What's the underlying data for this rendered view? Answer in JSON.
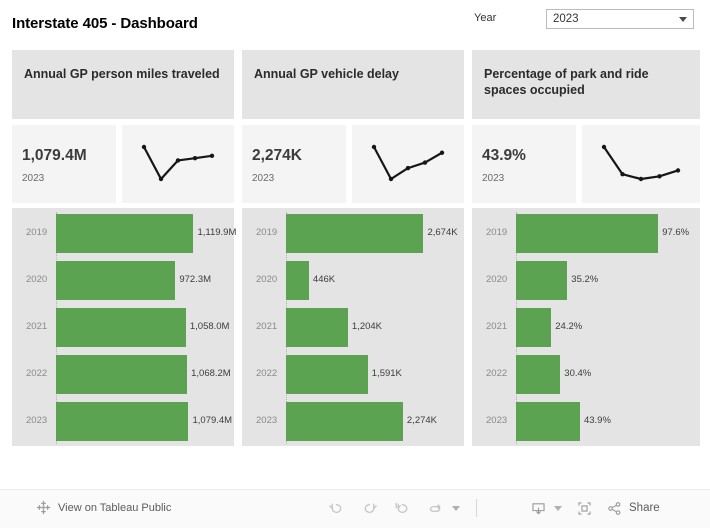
{
  "header": {
    "title": "Interstate 405 - Dashboard",
    "filter": {
      "label": "Year",
      "value": "2023",
      "caret_icon": "chevron-down-icon"
    }
  },
  "theme": {
    "bar_green": "#5ba351",
    "panel_gray": "#e4e4e4",
    "tile_gray": "#f4f4f4",
    "text_dark": "#3c3c3c",
    "axis_gray": "#8a8a8a"
  },
  "panels": [
    {
      "title": "Annual GP person miles traveled",
      "kpi_value": "1,079.4M",
      "kpi_year": "2023",
      "sparkline": [
        1119.9,
        972.3,
        1058.0,
        1068.2,
        1079.4
      ]
    },
    {
      "title": "Annual GP vehicle delay",
      "kpi_value": "2,274K",
      "kpi_year": "2023",
      "sparkline": [
        2674,
        446,
        1204,
        1591,
        2274
      ]
    },
    {
      "title": "Percentage of park and ride spaces occupied",
      "kpi_value": "43.9%",
      "kpi_year": "2023",
      "sparkline": [
        97.6,
        35.2,
        24.2,
        30.4,
        43.9
      ]
    }
  ],
  "chart_data": [
    {
      "type": "bar",
      "title": "Annual GP person miles traveled",
      "orientation": "horizontal",
      "categories": [
        "2019",
        "2020",
        "2021",
        "2022",
        "2023"
      ],
      "values": [
        1119.9,
        972.3,
        1058.0,
        1068.2,
        1079.4
      ],
      "labels": [
        "1,119.9M",
        "972.3M",
        "1,058.0M",
        "1,068.2M",
        "1,079.4M"
      ],
      "xlabel": "",
      "ylabel": "",
      "xlim": [
        0,
        1119.9
      ],
      "grid": false,
      "legend": "none",
      "color": "#5ba351"
    },
    {
      "type": "bar",
      "title": "Annual GP vehicle delay",
      "orientation": "horizontal",
      "categories": [
        "2019",
        "2020",
        "2021",
        "2022",
        "2023"
      ],
      "values": [
        2674,
        446,
        1204,
        1591,
        2274
      ],
      "labels": [
        "2,674K",
        "446K",
        "1,204K",
        "1,591K",
        "2,274K"
      ],
      "xlabel": "",
      "ylabel": "",
      "xlim": [
        0,
        2674
      ],
      "grid": false,
      "legend": "none",
      "color": "#5ba351"
    },
    {
      "type": "bar",
      "title": "Percentage of park and ride spaces occupied",
      "orientation": "horizontal",
      "categories": [
        "2019",
        "2020",
        "2021",
        "2022",
        "2023"
      ],
      "values": [
        97.6,
        35.2,
        24.2,
        30.4,
        43.9
      ],
      "labels": [
        "97.6%",
        "35.2%",
        "24.2%",
        "30.4%",
        "43.9%"
      ],
      "xlabel": "",
      "ylabel": "",
      "xlim": [
        0,
        97.6
      ],
      "grid": false,
      "legend": "none",
      "color": "#5ba351"
    }
  ],
  "toolbar": {
    "view_label": "View on Tableau Public",
    "logo_icon": "tableau-logo-icon",
    "undo_icon": "undo-icon",
    "redo_icon": "redo-icon",
    "revert_icon": "revert-icon",
    "refresh_icon": "refresh-icon",
    "refresh_caret_icon": "chevron-down-icon",
    "download_icon": "download-icon",
    "download_caret_icon": "chevron-down-icon",
    "fullscreen_icon": "fullscreen-icon",
    "share_icon": "share-icon",
    "share_label": "Share"
  }
}
